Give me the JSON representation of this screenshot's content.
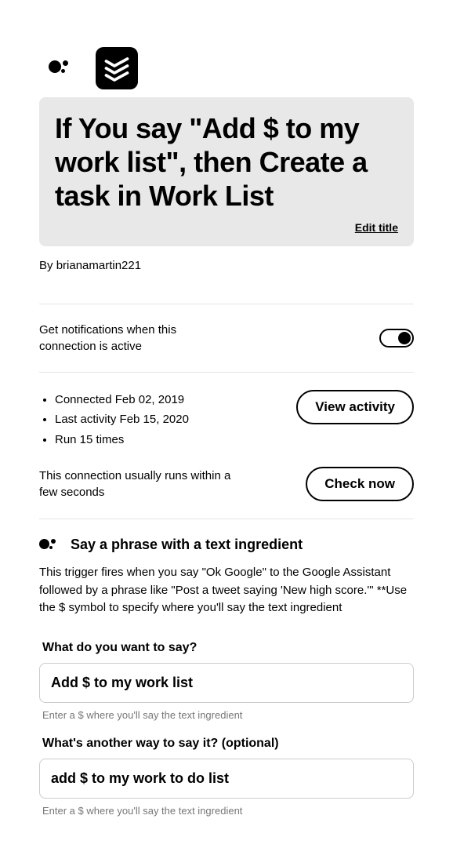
{
  "header": {
    "title": "If You say \"Add $ to my work list\", then Create a task in Work List",
    "edit_title_label": "Edit title",
    "byline_prefix": "By ",
    "author": "brianamartin221"
  },
  "notifications": {
    "label": "Get notifications when this connection is active",
    "enabled": true
  },
  "activity": {
    "connected": "Connected Feb 02, 2019",
    "last_activity": "Last activity Feb 15, 2020",
    "run_count": "Run 15 times",
    "view_label": "View activity",
    "check_text": "This connection usually runs within a few seconds",
    "check_label": "Check now"
  },
  "trigger": {
    "title": "Say a phrase with a text ingredient",
    "description": "This trigger fires when you say \"Ok Google\" to the Google Assistant followed by a phrase like \"Post a tweet saying 'New high score.'\" **Use the $ symbol to specify where you'll say the text ingredient",
    "fields": {
      "phrase1": {
        "label": "What do you want to say?",
        "value": "Add $ to my work list",
        "hint": "Enter a $ where you'll say the text ingredient"
      },
      "phrase2": {
        "label": "What's another way to say it? (optional)",
        "value": "add $ to my work to do list",
        "hint": "Enter a $ where you'll say the text ingredient"
      }
    }
  }
}
